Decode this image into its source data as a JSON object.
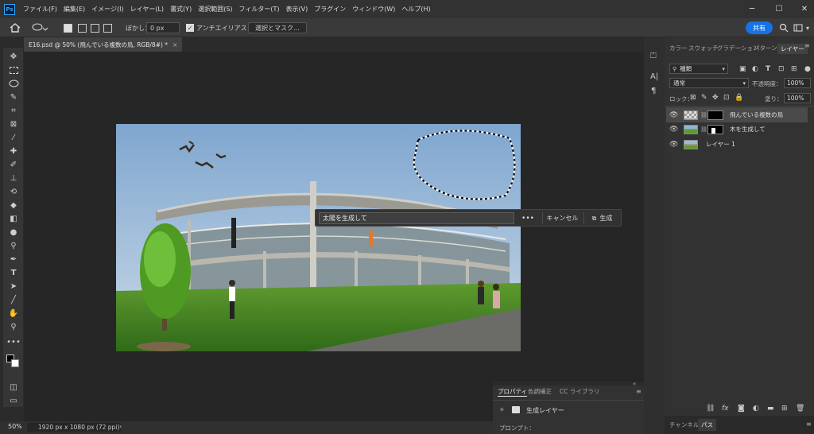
{
  "app": {
    "logo": "Ps"
  },
  "menu": [
    "ファイル(F)",
    "編集(E)",
    "イメージ(I)",
    "レイヤー(L)",
    "書式(Y)",
    "選択範囲(S)",
    "フィルター(T)",
    "表示(V)",
    "プラグイン",
    "ウィンドウ(W)",
    "ヘルプ(H)"
  ],
  "window_controls": {
    "minimize": "─",
    "maximize": "☐",
    "close": "✕"
  },
  "options": {
    "feather_label": "ぼかし：",
    "feather_value": "0 px",
    "antialias_label": "アンチエイリアス",
    "select_mask_label": "選択とマスク...",
    "share_label": "共有"
  },
  "document_tab": {
    "title": "E16.psd @ 50% (飛んでいる複数の鳥, RGB/8#) *",
    "close": "×"
  },
  "generate_bar": {
    "prompt_value": "太陽を生成して",
    "more": "•••",
    "cancel": "キャンセル",
    "generate": "生成"
  },
  "status": {
    "zoom": "50%",
    "doc_size": "1920 px x 1080 px (72 ppi)",
    "arrow": "›"
  },
  "properties": {
    "tabs": [
      "プロパティ",
      "色調補正",
      "CC ライブラリ"
    ],
    "layer_type": "生成レイヤー",
    "prompt_label": "プロンプト："
  },
  "right_panel": {
    "tabs": [
      "カラー",
      "スウォッチ",
      "グラデーション",
      "パターン",
      "レイヤー"
    ],
    "kind_filter": "種類",
    "blend_mode": "通常",
    "opacity_label": "不透明度：",
    "opacity_value": "100%",
    "lock_label": "ロック：",
    "fill_label": "塗り：",
    "fill_value": "100%",
    "bottom_tabs": [
      "チャンネル",
      "パス"
    ]
  },
  "layers": [
    {
      "name": "飛んでいる複数の鳥",
      "selected": true,
      "has_mask": true
    },
    {
      "name": "木を生成して",
      "selected": false,
      "has_mask": true
    },
    {
      "name": "レイヤー 1",
      "selected": false,
      "has_mask": false
    }
  ],
  "colors": {
    "accent": "#1473e6",
    "bg": "#2b2b2b",
    "panel": "#323232"
  }
}
